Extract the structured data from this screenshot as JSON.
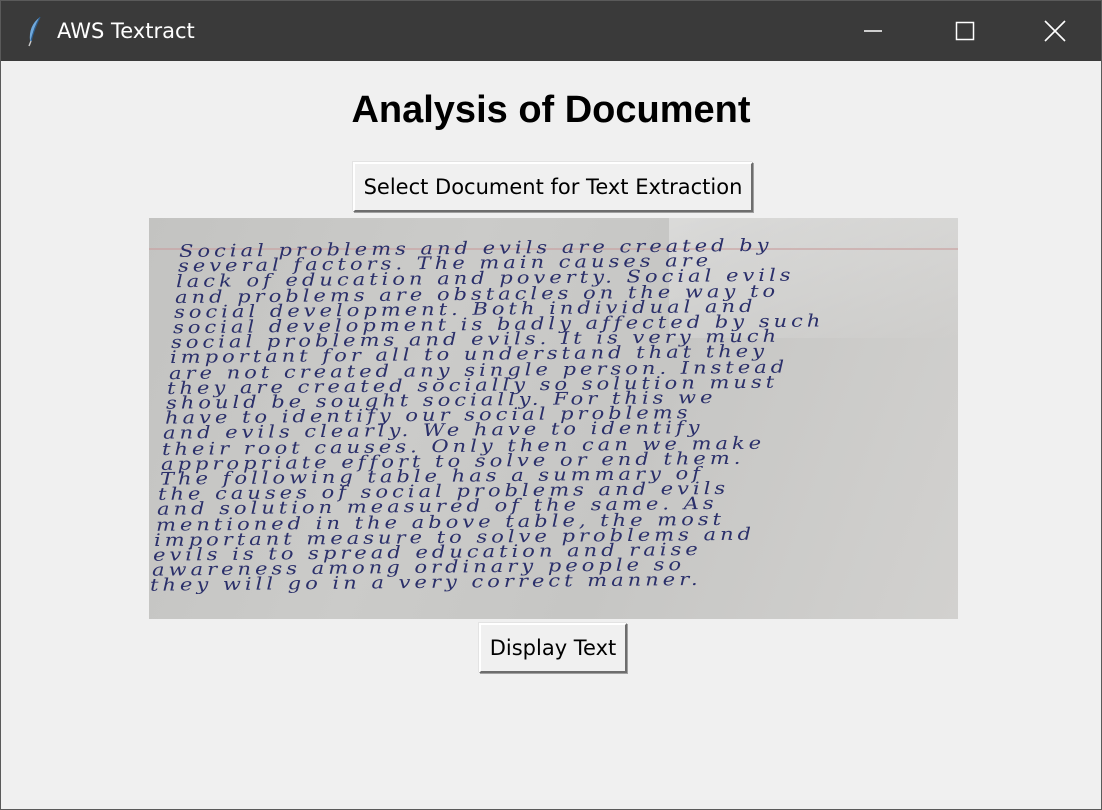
{
  "window": {
    "title": "AWS Textract",
    "icon": "feather-icon",
    "controls": [
      "minimize-icon",
      "maximize-icon",
      "close-icon"
    ]
  },
  "main": {
    "heading": "Analysis of Document",
    "select_button_label": "Select Document for Text Extraction",
    "display_button_label": "Display Text"
  },
  "document_image": {
    "description_icon": "handwritten-document-image",
    "lines": [
      "Social problems and evils are created by",
      "several factors. The main causes are",
      "lack of education and poverty. Social evils",
      "and problems are obstacles on the way to",
      "social development. Both individual and",
      "social development is badly affected by such",
      "social problems and evils. It is very much",
      "important for all to understand that they",
      "are not created any single person. Instead",
      "they are created socially so solution must",
      "should be sought socially. For this we",
      "have to identify our social problems",
      "and evils clearly. We have to identify",
      "their root causes. Only then can we make",
      "appropriate effort to solve or end them.",
      "The following table has a summary of",
      "the causes of social problems and evils",
      "and solution measured of the same. As",
      "mentioned in the above table, the most",
      "important measure to solve problems and",
      "evils is to spread education and raise",
      "awareness among ordinary people so",
      "they will go in a very correct manner."
    ]
  },
  "colors": {
    "titlebar": "#3a3a3a",
    "client_background": "#f0f0f0",
    "ink": "#2a2f6a"
  }
}
